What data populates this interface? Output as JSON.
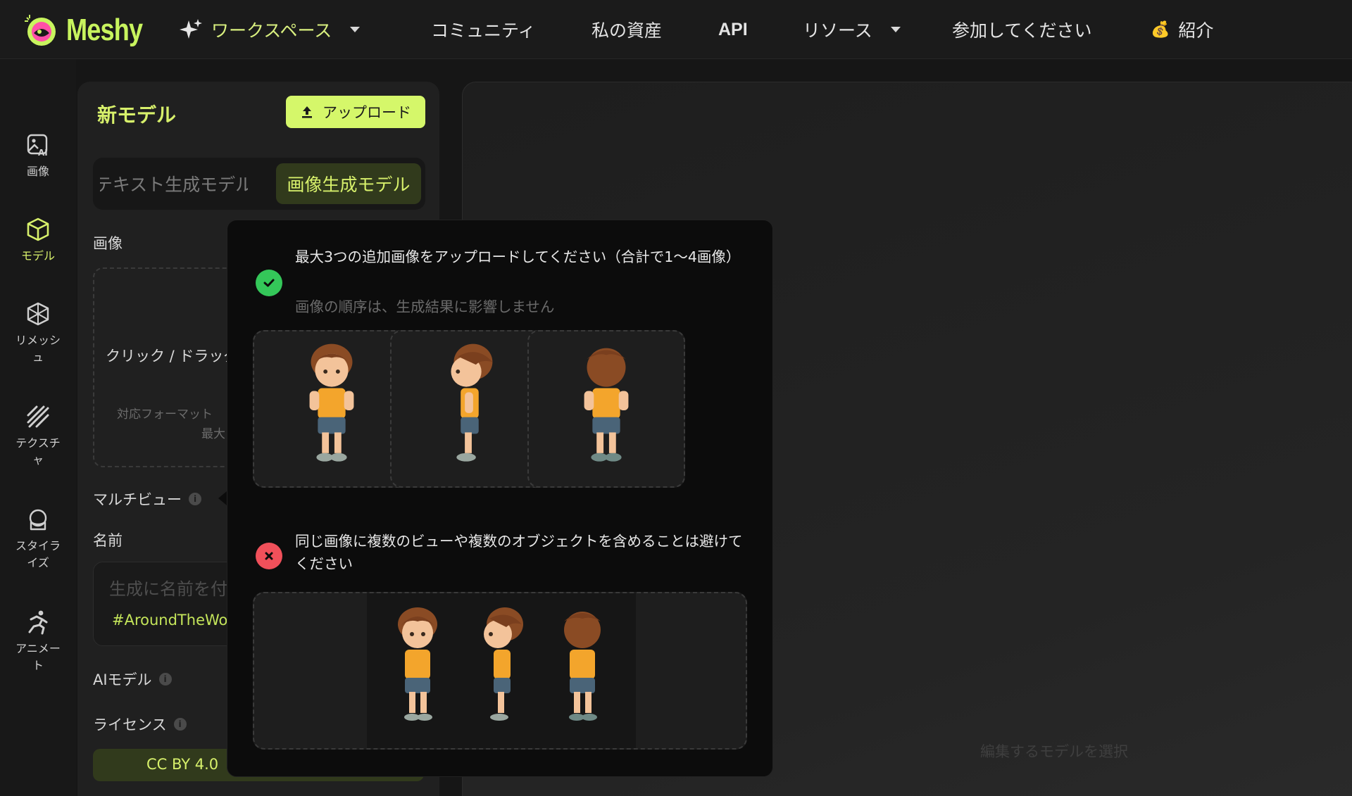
{
  "app": {
    "logo_text": "Meshy",
    "accent_color": "#d7f06b"
  },
  "nav": {
    "workspace": "ワークスペース",
    "community": "コミュニティ",
    "assets": "私の資産",
    "api": "API",
    "resources": "リソース",
    "join": "参加してください",
    "referral": "紹介",
    "referral_emoji": "💰"
  },
  "rail": {
    "items": [
      {
        "label": "画像",
        "icon": "image-ai-icon",
        "active": false
      },
      {
        "label": "モデル",
        "icon": "cube-icon",
        "active": true
      },
      {
        "label": "リメッシュ",
        "icon": "remesh-icon",
        "active": false
      },
      {
        "label": "テクスチャ",
        "icon": "texture-icon",
        "active": false
      },
      {
        "label": "スタイライズ",
        "icon": "stylize-icon",
        "active": false
      },
      {
        "label": "アニメート",
        "icon": "running-icon",
        "active": false
      }
    ]
  },
  "panel": {
    "title": "新モデル",
    "upload_label": "アップロード",
    "tab_text": "テキスト生成モデル",
    "tab_image": "画像生成モデル",
    "image_label": "画像",
    "dropzone_text": "クリック / ドラッグ",
    "dropzone_formats": "対応フォーマット",
    "dropzone_max": "最大",
    "multiview_label": "マルチビュー",
    "name_label": "名前",
    "name_placeholder": "生成に名前を付",
    "name_tag": "#AroundTheWorld",
    "ai_model_label": "AIモデル",
    "license_label": "ライセンス",
    "license_value": "CC BY 4.0"
  },
  "popover": {
    "ok_title": "最大3つの追加画像をアップロードしてください（合計で1〜4画像）",
    "ok_sub": "画像の順序は、生成結果に影響しません",
    "bad_title": "同じ画像に複数のビューや複数のオブジェクトを含めることは避けてください",
    "ok_icon": "check-icon",
    "bad_icon": "x-icon",
    "ok_color": "#34c759",
    "bad_color": "#f0505a"
  },
  "canvas": {
    "hint": "編集するモデルを選択"
  }
}
